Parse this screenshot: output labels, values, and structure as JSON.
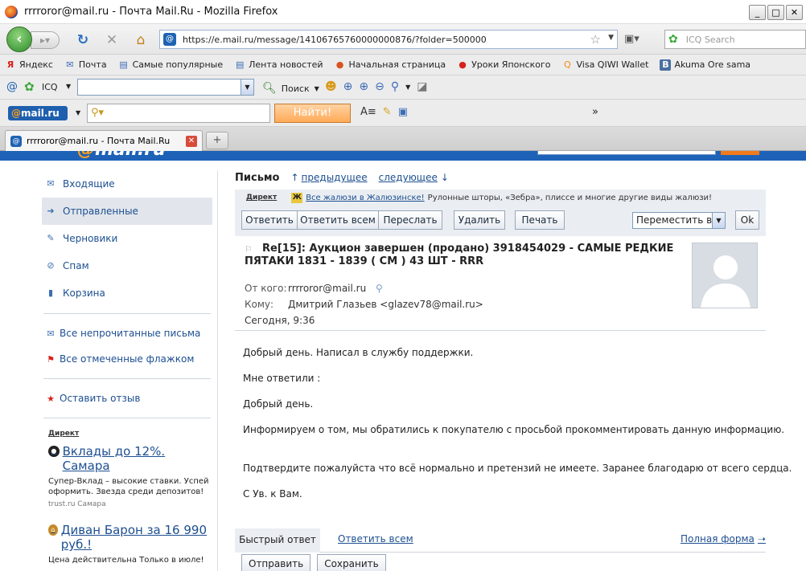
{
  "browser": {
    "window_title": "rrrroror@mail.ru - Почта Mail.Ru - Mozilla Firefox",
    "url": "https://e.mail.ru/message/14106765760000000876/?folder=500000",
    "icq_search_placeholder": "ICQ Search",
    "tab_title": "rrrroror@mail.ru - Почта Mail.Ru",
    "window_buttons": [
      "_",
      "□",
      "✕"
    ]
  },
  "bookmarks": [
    {
      "label": "Яндекс",
      "icon": "yandex-icon",
      "color": "#d8201c"
    },
    {
      "label": "Почта",
      "icon": "mail-icon",
      "color": "#3b6bb5"
    },
    {
      "label": "Самые популярные",
      "icon": "page-icon",
      "color": "#3b6bb5"
    },
    {
      "label": "Лента новостей",
      "icon": "rss-icon",
      "color": "#3b6bb5"
    },
    {
      "label": "Начальная страница",
      "icon": "firefox-icon",
      "color": "#d9531e"
    },
    {
      "label": "Уроки Японского",
      "icon": "red-dot-icon",
      "color": "#d8201c"
    },
    {
      "label": "Visa QIWI Wallet",
      "icon": "qiwi-icon",
      "color": "#f28c1a"
    },
    {
      "label": "Akuma Ore sama",
      "icon": "vk-icon",
      "color": "#4a6fa0"
    }
  ],
  "icq_toolbar": {
    "label": "ICQ",
    "search_label": "Поиск"
  },
  "mail_toolbar": {
    "logo_prefix": "@",
    "logo_text": "mail.ru",
    "find_button": "Найти!",
    "more": "»"
  },
  "sidebar": {
    "folders": [
      {
        "label": "Входящие",
        "icon": "envelope-icon",
        "active": false
      },
      {
        "label": "Отправленные",
        "icon": "arrow-right-icon",
        "active": true
      },
      {
        "label": "Черновики",
        "icon": "pencil-icon",
        "active": false
      },
      {
        "label": "Спам",
        "icon": "ban-icon",
        "active": false
      },
      {
        "label": "Корзина",
        "icon": "trash-icon",
        "active": false
      }
    ],
    "links": [
      {
        "label": "Все непрочитанные письма",
        "icon": "envelope-icon"
      },
      {
        "label": "Все отмеченные флажком",
        "icon": "flag-icon"
      }
    ],
    "feedback": "Оставить отзыв",
    "direct_label": "Директ",
    "ads": [
      {
        "title": "Вклады до 12%. Самара",
        "text": "Супер-Вклад – высокие ставки. Успей оформить. Звезда среди депозитов!",
        "source": "trust.ru  Самара"
      },
      {
        "title": "Диван Барон за 16 990 руб.!",
        "text": "Цена действительна Только в июле!",
        "source": ""
      }
    ]
  },
  "main": {
    "page_title": "Письмо",
    "prev_link": "предыдущее",
    "next_link": "следующее",
    "ad": {
      "label": "Директ",
      "icon_letter": "Ж",
      "link": "Все жалюзи в Жалюзинске!",
      "text": "Рулонные шторы, «Зебра», плиссе и многие другие виды жалюзи!"
    },
    "actions": {
      "reply": "Ответить",
      "reply_all": "Ответить всем",
      "forward": "Переслать",
      "delete": "Удалить",
      "print": "Печать",
      "move": "Переместить в",
      "ok": "Ok"
    },
    "message": {
      "subject": "Re[15]: Аукцион завершен (продано) 3918454029 - САМЫЕ РЕДКИЕ ПЯТАКИ 1831 - 1839 ( СМ ) 43 ШТ - RRR",
      "from_label": "От кого:",
      "from": "rrrroror@mail.ru",
      "to_label": "Кому:",
      "to": "Дмитрий Глазьев <glazev78@mail.ru>",
      "date": "Сегодня, 9:36",
      "body": [
        "Добрый день. Написал в службу поддержки.",
        "Мне ответили :",
        "Добрый день.",
        "Информируем о том, мы обратились к покупателю с просьбой прокомментировать данную информацию.",
        "Подтвердите пожалуйста что всё нормально и претензий не имеете. Заранее благодарю от всего сердца.",
        "С Ув. к Вам."
      ]
    },
    "quick_reply": {
      "tab": "Быстрый ответ",
      "reply_all": "Ответить всем",
      "full_form": "Полная форма",
      "send": "Отправить",
      "save": "Сохранить"
    }
  }
}
